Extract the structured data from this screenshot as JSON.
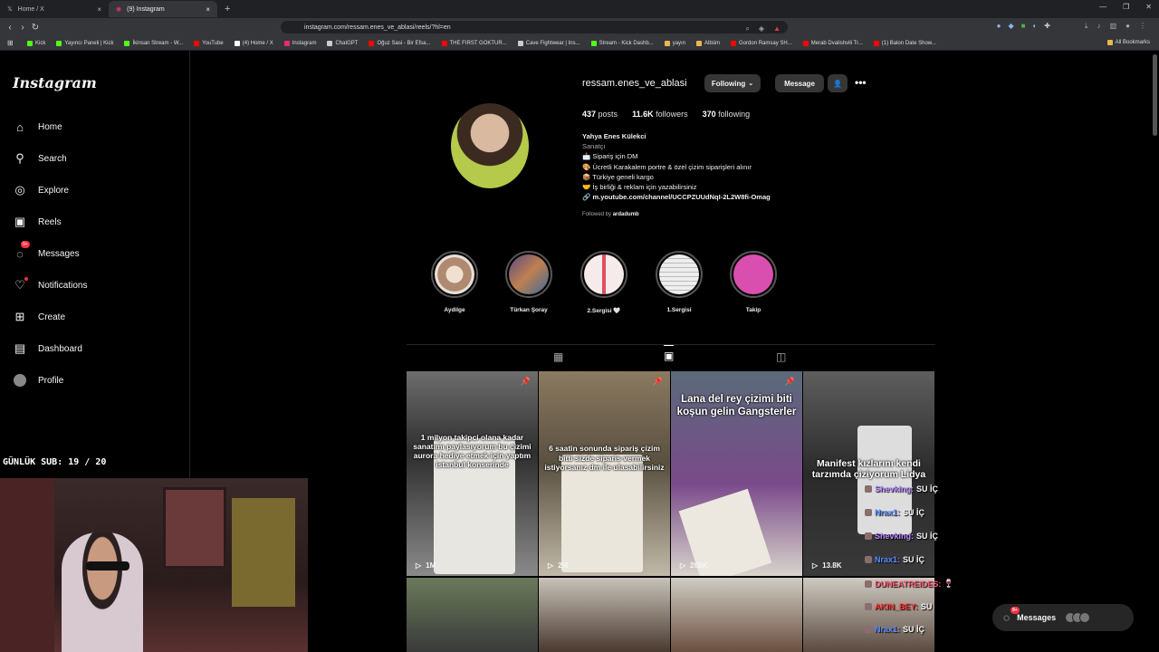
{
  "browser": {
    "tabs": [
      {
        "title": "Home / X",
        "icon": "x-icon",
        "active": false
      },
      {
        "title": "(9) Instagram",
        "icon": "instagram-icon",
        "active": true
      }
    ],
    "url": "instagram.com/ressam.enes_ve_ablasi/reels/?hl=en",
    "bookmarks": [
      "Kick",
      "Yayıncı Paneli | Kick",
      "İkinsan Stream - W...",
      "YouTube",
      "(4) Home / X",
      "Instagram",
      "ChatGPT",
      "Oğuz Sasi - Bir Efsa...",
      "THE FIRST GOKTUR...",
      "Cave Fightwear | Ins...",
      "Stream - Kick Dashb...",
      "yayın",
      "Albüm",
      "Gordon Ramsay SH...",
      "Merab Dvalishvili Tr...",
      "(1) Balon Date Show..."
    ],
    "all_bookmarks": "All Bookmarks"
  },
  "sidebar": {
    "logo": "Instagram",
    "items": [
      {
        "label": "Home",
        "icon": "home-icon"
      },
      {
        "label": "Search",
        "icon": "search-icon"
      },
      {
        "label": "Explore",
        "icon": "compass-icon"
      },
      {
        "label": "Reels",
        "icon": "reels-icon"
      },
      {
        "label": "Messages",
        "icon": "messenger-icon",
        "badge": "9+"
      },
      {
        "label": "Notifications",
        "icon": "heart-icon"
      },
      {
        "label": "Create",
        "icon": "plus-square-icon"
      },
      {
        "label": "Dashboard",
        "icon": "chart-icon"
      },
      {
        "label": "Profile",
        "icon": "avatar-icon"
      }
    ]
  },
  "profile": {
    "username": "ressam.enes_ve_ablasi",
    "following_btn": "Following",
    "message_btn": "Message",
    "posts_count": "437",
    "posts_label": "posts",
    "followers_count": "11.6K",
    "followers_label": "followers",
    "following_count": "370",
    "following_label": "following",
    "full_name": "Yahya Enes Külekci",
    "category": "Sanatçı",
    "bio_lines": [
      "📩 Sipariş için DM",
      "🎨 Ücretli Karakalem portre & özel çizim siparişleri alınır",
      "📦 Türkiye geneli kargo",
      "🤝 İş birliği & reklam için yazabilirsiniz"
    ],
    "link": "m.youtube.com/channel/UCCPZUUdNqI-2L2W8fi-Omag",
    "followed_by_prefix": "Followed by",
    "followed_by": "ardadumb"
  },
  "highlights": [
    {
      "label": "Aydilge",
      "color": "#c9a88a"
    },
    {
      "label": "Türkan Şoray",
      "color": "#6a5a8a"
    },
    {
      "label": "2.Sergisi 🤍",
      "color": "#f2e6e6"
    },
    {
      "label": "1.Sergisi",
      "color": "#e8e8e8"
    },
    {
      "label": "Takip",
      "color": "#d94fb0"
    }
  ],
  "reels": [
    {
      "caption": "1 milyon takipci olana kadar sanatımı paylasıyorum bu çizimi aurora hediye etmek için yaptım istanbul konserinde",
      "views": "1M",
      "pinned": true
    },
    {
      "caption": "6 saatin sonunda sipariş çizim bitti sizde siparis vermek istiyorsanız dm ile ulasabilirsiniz",
      "views": "2M",
      "pinned": true
    },
    {
      "caption": "Lana del rey çizimi biti koşun gelin Gangsterler",
      "views": "268K",
      "pinned": true
    },
    {
      "caption": "Manifest kızlarını kendi tarzımda çiziyorum Lidya",
      "views": "13.8K",
      "pinned": false
    }
  ],
  "overlay": {
    "sub_counter": "GÜNLÜK SUB: 19 / 20",
    "chat": [
      {
        "user": "Shevking:",
        "msg": "SU İÇ",
        "color": "#b98cff"
      },
      {
        "user": "Nrax1:",
        "msg": "SU İÇ",
        "color": "#5b8cff"
      },
      {
        "user": "Shevking:",
        "msg": "SU İÇ",
        "color": "#b98cff"
      },
      {
        "user": "Nrax1:",
        "msg": "SU İÇ",
        "color": "#5b8cff"
      },
      {
        "user": "DUNEATREIDES:",
        "msg": "🍷",
        "color": "#ff5a7a"
      },
      {
        "user": "AKIN_BEY:",
        "msg": "SU",
        "color": "#ff3030"
      },
      {
        "user": "Nrax1:",
        "msg": "SU İÇ",
        "color": "#5b8cff"
      }
    ]
  },
  "messages_pill": {
    "label": "Messages",
    "badge": "9+"
  }
}
